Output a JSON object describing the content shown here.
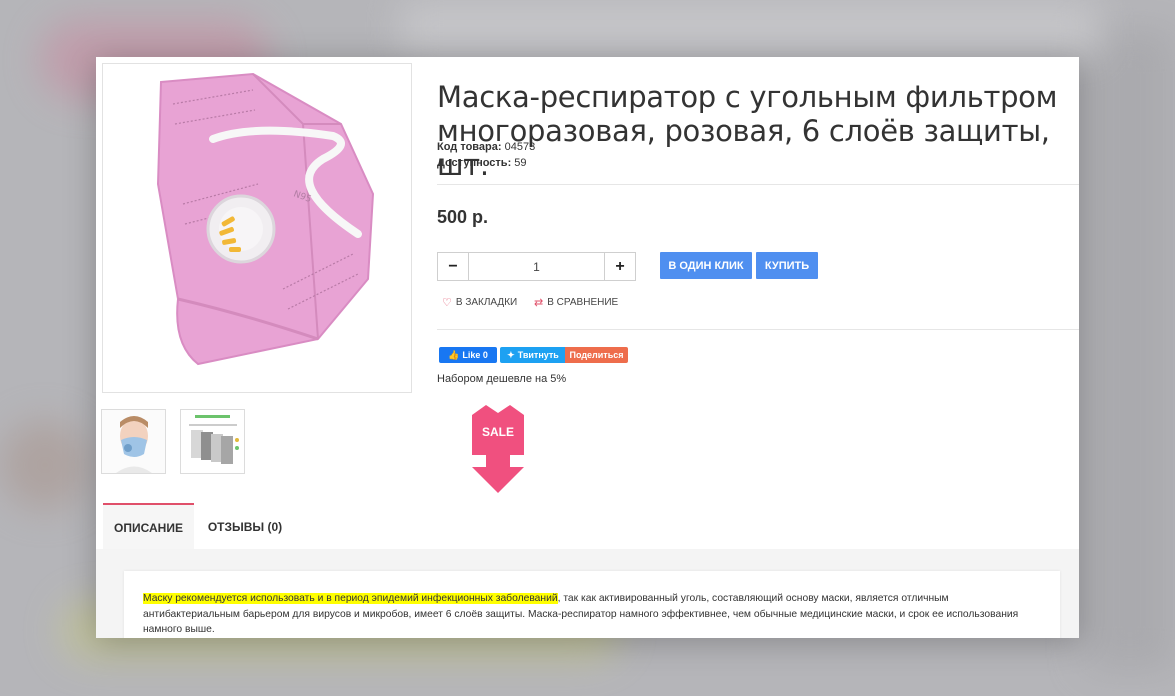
{
  "product": {
    "title": "Маска-респиратор с угольным фильтром многоразовая, розовая, 6 слоёв защиты, шт.",
    "sku_label": "Код товара:",
    "sku_value": "04573",
    "availability_label": "Доступность:",
    "availability_value": "59",
    "price": "500 р."
  },
  "quantity": {
    "value": "1",
    "minus_icon": "minus-icon",
    "plus_icon": "plus-icon"
  },
  "buttons": {
    "one_click": "В ОДИН КЛИК",
    "buy": "КУПИТЬ"
  },
  "links": {
    "bookmark": "В ЗАКЛАДКИ",
    "compare": "В СРАВНЕНИЕ"
  },
  "social": {
    "facebook": "Like 0",
    "twitter": "Твитнуть",
    "share": "Поделиться"
  },
  "bundle_note": "Набором дешевле на 5%",
  "sale_badge": "SALE",
  "tabs": [
    {
      "label": "ОПИСАНИЕ",
      "active": true
    },
    {
      "label": "ОТЗЫВЫ (0)",
      "active": false
    }
  ],
  "description": {
    "highlighted": "Маску рекомендуется использовать и в период эпидемий инфекционных заболеваний",
    "rest": ", так как активированный уголь, составляющий основу маски, является отличным антибактериальным барьером для вирусов и микробов, имеет 6 слоёв защиты. Маска-респиратор намного эффективнее, чем обычные медицинские маски, и срок ее использования намного выше."
  },
  "colors": {
    "accent_blue": "#4f8ff0",
    "sale_pink": "#f0507f",
    "tab_accent": "#e0506a",
    "mask_pink": "#e8a3d4",
    "highlight": "#ffff00"
  }
}
